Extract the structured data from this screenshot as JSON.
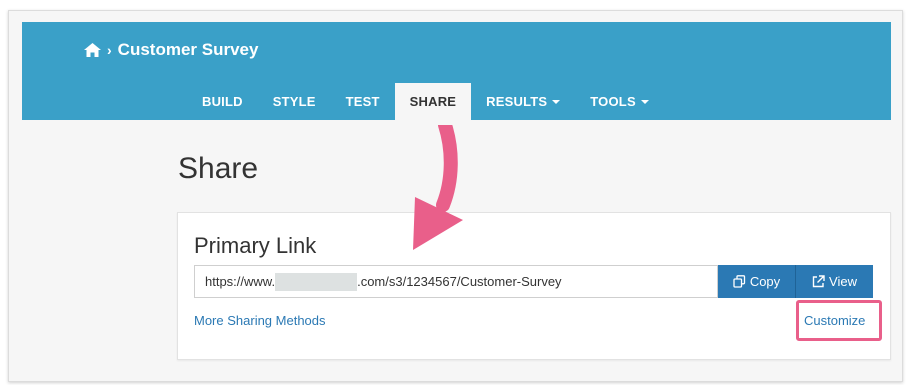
{
  "header": {
    "breadcrumb_title": "Customer Survey",
    "icons": {
      "home": "home-icon",
      "separator": "chevron-right-icon"
    }
  },
  "nav": {
    "items": [
      {
        "label": "BUILD",
        "active": false,
        "dropdown": false
      },
      {
        "label": "STYLE",
        "active": false,
        "dropdown": false
      },
      {
        "label": "TEST",
        "active": false,
        "dropdown": false
      },
      {
        "label": "SHARE",
        "active": true,
        "dropdown": false
      },
      {
        "label": "RESULTS",
        "active": false,
        "dropdown": true
      },
      {
        "label": "TOOLS",
        "active": false,
        "dropdown": true
      }
    ]
  },
  "page": {
    "title": "Share"
  },
  "primary_link": {
    "title": "Primary Link",
    "url_prefix": "https://www.",
    "url_suffix": ".com/s3/1234567/Customer-Survey",
    "copy_label": "Copy",
    "view_label": "View",
    "more_label": "More Sharing Methods",
    "customize_label": "Customize"
  },
  "colors": {
    "header_bg": "#3aa0c8",
    "button_bg": "#2b79b4",
    "annotation": "#e95f8a",
    "link": "#2b79b4"
  }
}
